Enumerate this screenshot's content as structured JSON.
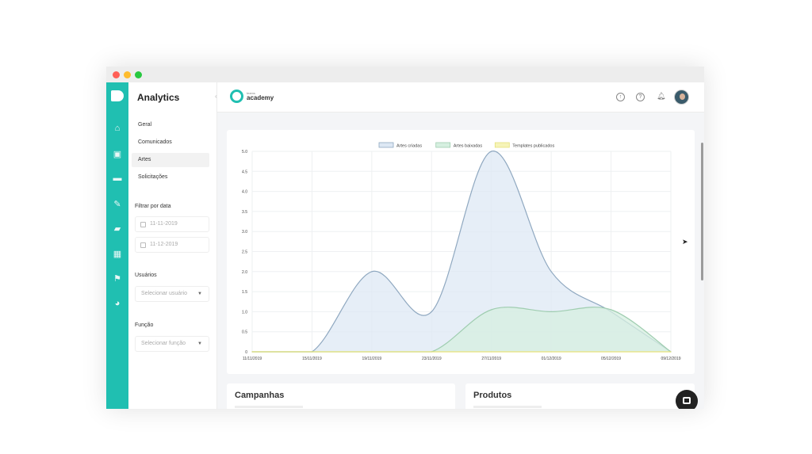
{
  "sidebar": {
    "title": "Analytics",
    "nav": [
      {
        "label": "Geral"
      },
      {
        "label": "Comunicados"
      },
      {
        "label": "Artes"
      },
      {
        "label": "Solicitações"
      }
    ],
    "date_filter_label": "Filtrar por data",
    "date_start": "11-11-2019",
    "date_end": "11-12-2019",
    "users_label": "Usuários",
    "users_placeholder": "Selecionar usuário",
    "role_label": "Função",
    "role_placeholder": "Selecionar função"
  },
  "topbar": {
    "brand_small": "teams",
    "brand_big": "academy"
  },
  "cards": {
    "campaigns": "Campanhas",
    "products": "Produtos"
  },
  "colors": {
    "accent": "#20bfb1",
    "series_created": "#dde8f4",
    "series_created_line": "#8fa8c0",
    "series_reused": "#d6efe0",
    "series_reused_line": "#9fcdb0",
    "series_published": "#f6f4b8"
  },
  "chart_data": {
    "type": "area",
    "x": [
      "11/11/2019",
      "15/11/2019",
      "19/11/2019",
      "23/11/2019",
      "27/11/2019",
      "01/12/2019",
      "05/12/2019",
      "09/12/2019"
    ],
    "series": [
      {
        "name": "Artes criadas",
        "values": [
          0,
          0,
          2.0,
          1.0,
          5.0,
          2.0,
          1.0,
          0
        ]
      },
      {
        "name": "Artes baixadas",
        "values": [
          0,
          0,
          0,
          0,
          1.05,
          1.0,
          1.05,
          0
        ]
      },
      {
        "name": "Templates publicados",
        "values": [
          0,
          0,
          0,
          0,
          0,
          0,
          0,
          0
        ]
      }
    ],
    "yticks": [
      "0",
      "0.5",
      "1.0",
      "1.5",
      "2.0",
      "2.5",
      "3.0",
      "3.5",
      "4.0",
      "4.5",
      "5.0"
    ],
    "ylim": [
      0,
      5
    ],
    "grid": true,
    "legend": "top-center"
  }
}
